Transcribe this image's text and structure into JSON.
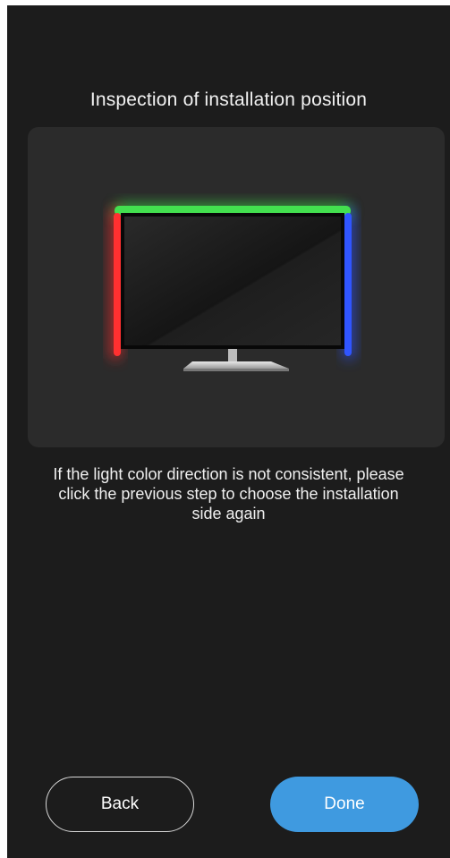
{
  "screen": {
    "title": "Inspection of installation position",
    "instruction": "If the light color direction is not consistent, please click the previous step to choose the installation side again"
  },
  "preview": {
    "illustration": "tv-with-ambient-light-strips",
    "light_colors": {
      "top": "#3cdc4a",
      "left": "#ff2a2a",
      "right": "#2c52ff"
    }
  },
  "actions": {
    "back_label": "Back",
    "done_label": "Done"
  },
  "colors": {
    "background": "#1c1c1c",
    "card": "#2b2b2b",
    "accent": "#3f9ae0",
    "text": "#f2f2f2"
  }
}
